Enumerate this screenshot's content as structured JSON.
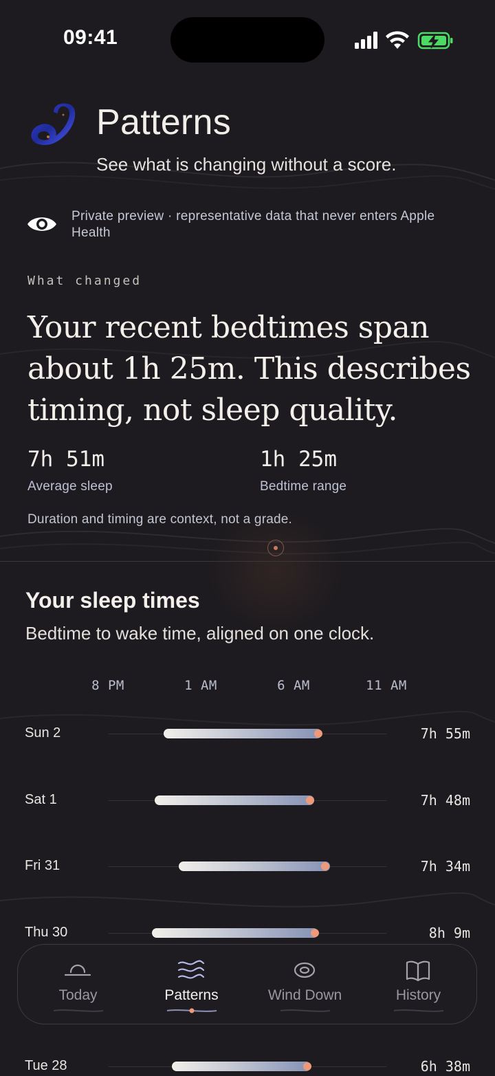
{
  "status": {
    "time": "09:41"
  },
  "header": {
    "title": "Patterns",
    "subtitle": "See what is changing without a score."
  },
  "notice": {
    "icon": "eye-icon",
    "text": "Private preview · representative data that never enters Apple Health"
  },
  "summary": {
    "eyebrow": "What changed",
    "headline": "Your recent bedtimes span about 1h 25m. This describes timing, not sleep quality.",
    "stats": [
      {
        "value": "7h 51m",
        "label": "Average sleep"
      },
      {
        "value": "1h 25m",
        "label": "Bedtime range"
      }
    ],
    "note": "Duration and timing are context, not a grade."
  },
  "sleep_times": {
    "title": "Your sleep times",
    "subtitle": "Bedtime to wake time, aligned on one clock.",
    "axis": [
      "8 PM",
      "1 AM",
      "6 AM",
      "11 AM"
    ],
    "rows": [
      {
        "day": "Sun 2",
        "duration": "7h 55m"
      },
      {
        "day": "Sat 1",
        "duration": "7h 48m"
      },
      {
        "day": "Fri 31",
        "duration": "7h 34m"
      },
      {
        "day": "Thu 30",
        "duration": "8h 9m"
      },
      {
        "day": "Tue 28",
        "duration": "6h 38m"
      }
    ]
  },
  "tabs": [
    {
      "label": "Today",
      "icon": "sunrise-icon",
      "active": false
    },
    {
      "label": "Patterns",
      "icon": "waves-icon",
      "active": true
    },
    {
      "label": "Wind Down",
      "icon": "spiral-icon",
      "active": false
    },
    {
      "label": "History",
      "icon": "book-icon",
      "active": false
    }
  ],
  "colors": {
    "background": "#1d1b1f",
    "accent": "#ee9a7a",
    "bar_start": "#f2efea",
    "bar_end": "#8592b5",
    "battery": "#4cd964"
  }
}
